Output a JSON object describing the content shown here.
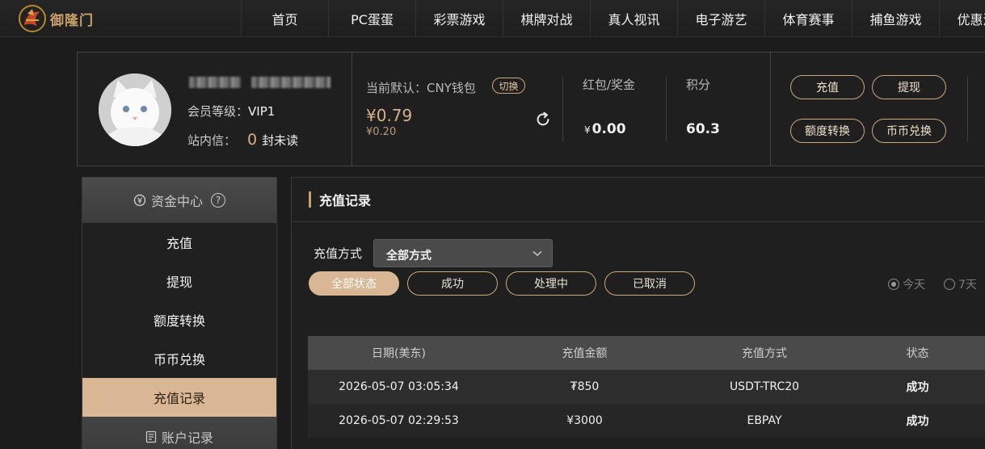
{
  "brand": {
    "logo_text": "御隆门"
  },
  "nav": [
    "首页",
    "PC蛋蛋",
    "彩票游戏",
    "棋牌对战",
    "真人视讯",
    "电子游艺",
    "体育赛事",
    "捕鱼游戏",
    "优惠活动"
  ],
  "profile": {
    "vip_label": "会员等级：",
    "vip_value": "VIP1",
    "message_label": "站内信：",
    "message_count": "0",
    "message_unread": "封未读",
    "wallet_label": "当前默认：CNY钱包",
    "switch_label": "切换",
    "balance": "¥0.79",
    "balance_sub": "¥0.20",
    "hongbao_label": "红包/奖金",
    "hongbao_currency": "¥",
    "hongbao_value": "0.00",
    "points_label": "积分",
    "points_value": "60.3",
    "actions": [
      "充值",
      "提现",
      "额度转换",
      "币币兑换"
    ]
  },
  "sidebar": {
    "header": "资金中心",
    "help": "?",
    "items": [
      "充值",
      "提现",
      "额度转换",
      "币币兑换",
      "充值记录"
    ],
    "active_index": 4,
    "footer": "账户记录"
  },
  "main": {
    "title": "充值记录",
    "method_label": "充值方式",
    "method_selected": "全部方式",
    "tabs": [
      "全部状态",
      "成功",
      "处理中",
      "已取消"
    ],
    "active_tab": 0,
    "range": [
      "今天",
      "7天"
    ],
    "active_range": 0,
    "table": {
      "headers": [
        "日期(美东)",
        "充值金额",
        "充值方式",
        "状态"
      ],
      "rows": [
        [
          "2026-05-07 03:05:34",
          "₮850",
          "USDT-TRC20",
          "成功"
        ],
        [
          "2026-05-07 02:29:53",
          "¥3000",
          "EBPAY",
          "成功"
        ]
      ]
    }
  },
  "colors": {
    "accent": "#d9b794",
    "gold": "#c9a06a",
    "background": "#1c1c1c"
  }
}
